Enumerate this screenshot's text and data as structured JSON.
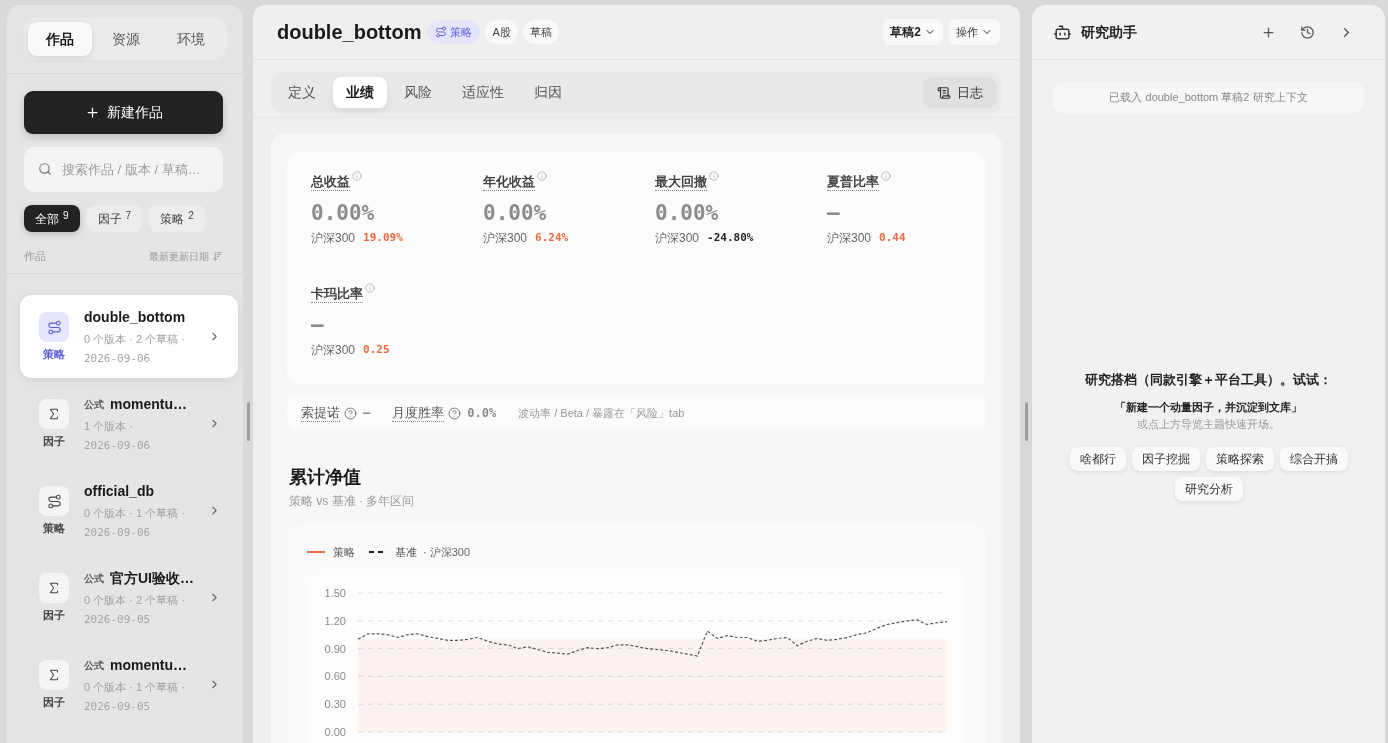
{
  "sidebar": {
    "tabs": [
      {
        "label": "作品",
        "selected": true
      },
      {
        "label": "资源",
        "selected": false
      },
      {
        "label": "环境",
        "selected": false
      }
    ],
    "new_button": "新建作品",
    "search": {
      "placeholder": "搜索作品 / 版本 / 草稿…"
    },
    "filters": [
      {
        "label": "全部",
        "count": "9",
        "selected": true
      },
      {
        "label": "因子",
        "count": "7",
        "selected": false
      },
      {
        "label": "策略",
        "count": "2",
        "selected": false
      }
    ],
    "list_header": {
      "title": "作品",
      "sort_label": "最新更新日期"
    },
    "items": [
      {
        "kind": "strategy",
        "type_label": "策略",
        "title": "double_bottom",
        "meta": "0 个版本 · 2 个草稿 ·",
        "date": "2026-09-06",
        "selected": true
      },
      {
        "kind": "factor",
        "type_label": "因子",
        "tag": "公式",
        "title": "momentu…",
        "meta": "1 个版本 ·",
        "date": "2026-09-06",
        "selected": false
      },
      {
        "kind": "strategy",
        "type_label": "策略",
        "title": "official_db",
        "meta": "0 个版本 · 1 个草稿 ·",
        "date": "2026-09-06",
        "selected": false
      },
      {
        "kind": "factor",
        "type_label": "因子",
        "tag": "公式",
        "title": "官方UI验收…",
        "meta": "0 个版本 · 2 个草稿 ·",
        "date": "2026-09-05",
        "selected": false
      },
      {
        "kind": "factor",
        "type_label": "因子",
        "tag": "公式",
        "title": "momentu…",
        "meta": "0 个版本 · 1 个草稿 ·",
        "date": "2026-09-05",
        "selected": false
      }
    ]
  },
  "main": {
    "title": "double_bottom",
    "badges": [
      {
        "kind": "type",
        "label": "策略"
      },
      {
        "kind": "plain",
        "label": "A股"
      },
      {
        "kind": "plain",
        "label": "草稿"
      }
    ],
    "draft_menu": "草稿2",
    "actions_menu": "操作",
    "tabs": [
      {
        "label": "定义",
        "selected": false
      },
      {
        "label": "业绩",
        "selected": true
      },
      {
        "label": "风险",
        "selected": false
      },
      {
        "label": "适应性",
        "selected": false
      },
      {
        "label": "归因",
        "selected": false
      }
    ],
    "log_button": "日志",
    "metrics": [
      {
        "label": "总收益",
        "value": "0.00%",
        "benchmark_label": "沪深300",
        "benchmark_value": "19.09%",
        "color": "#ec6a3f"
      },
      {
        "label": "年化收益",
        "value": "0.00%",
        "benchmark_label": "沪深300",
        "benchmark_value": "6.24%",
        "color": "#ec6a3f"
      },
      {
        "label": "最大回撤",
        "value": "0.00%",
        "benchmark_label": "沪深300",
        "benchmark_value": "-24.80%",
        "color": "#1f1f1f"
      },
      {
        "label": "夏普比率",
        "value": "—",
        "benchmark_label": "沪深300",
        "benchmark_value": "0.44",
        "color": "#ec6a3f"
      },
      {
        "label": "卡玛比率",
        "value": "—",
        "benchmark_label": "沪深300",
        "benchmark_value": "0.25",
        "color": "#ec6a3f"
      }
    ],
    "stats": [
      {
        "label": "索提诺",
        "value": "—"
      },
      {
        "label": "月度胜率",
        "value": "0.0%"
      }
    ],
    "stats_note": "波动率 / Beta / 暴露在「风险」tab",
    "chart_section": {
      "title": "累计净值",
      "subtitle": "策略 vs 基准 · 多年区间",
      "legend_note": "· 沪深300",
      "chart_data": {
        "type": "line",
        "grid": true,
        "ylim": [
          0,
          1.5
        ],
        "yticks": [
          {
            "value": 1.5,
            "label": "1.50"
          },
          {
            "value": 1.2,
            "label": "1.20"
          },
          {
            "value": 0.9,
            "label": "0.90"
          },
          {
            "value": 0.6,
            "label": "0.60"
          },
          {
            "value": 0.3,
            "label": "0.30"
          },
          {
            "value": 0,
            "label": "0.00"
          }
        ],
        "series": [
          {
            "name": "策略",
            "type": "area",
            "color": "#ec6a3f",
            "values": [
              1,
              1,
              1,
              1,
              1,
              1,
              1,
              1,
              1,
              1,
              1,
              1,
              1,
              1,
              1,
              1,
              1,
              1,
              1,
              1,
              1,
              1,
              1,
              1,
              1,
              1,
              1,
              1,
              1,
              1,
              1,
              1,
              1,
              1,
              1,
              1,
              1,
              1,
              1,
              1,
              1,
              1,
              1,
              1,
              1,
              1,
              1,
              1,
              1,
              1,
              1,
              1,
              1,
              1,
              1,
              1,
              1,
              1,
              1,
              1
            ]
          },
          {
            "name": "基准",
            "type": "line",
            "line_style": "dashed",
            "color": "#222222",
            "values": [
              1.0,
              1.06,
              1.06,
              1.05,
              1.02,
              1.05,
              1.06,
              1.03,
              1.01,
              0.99,
              0.99,
              1.0,
              1.02,
              0.98,
              0.95,
              0.94,
              0.9,
              0.92,
              0.89,
              0.86,
              0.85,
              0.84,
              0.88,
              0.91,
              0.9,
              0.91,
              0.94,
              0.94,
              0.92,
              0.9,
              0.89,
              0.88,
              0.86,
              0.84,
              0.82,
              1.09,
              1.01,
              1.04,
              1.02,
              1.02,
              0.98,
              0.99,
              1.01,
              1.02,
              0.93,
              0.98,
              1.01,
              0.99,
              1.0,
              1.02,
              1.05,
              1.07,
              1.12,
              1.16,
              1.18,
              1.2,
              1.21,
              1.16,
              1.18,
              1.19
            ]
          }
        ]
      }
    }
  },
  "assistant": {
    "title": "研究助手",
    "context": "已载入 double_bottom 草稿2 研究上下文",
    "intro": "研究搭档（同款引擎＋平台工具）。试试：",
    "example": "「新建一个动量因子，并沉淀到文库」",
    "hint": "或点上方导览主题快速开场。",
    "topics": [
      "啥都行",
      "因子挖掘",
      "策略探索",
      "综合开搞",
      "研究分析"
    ]
  }
}
